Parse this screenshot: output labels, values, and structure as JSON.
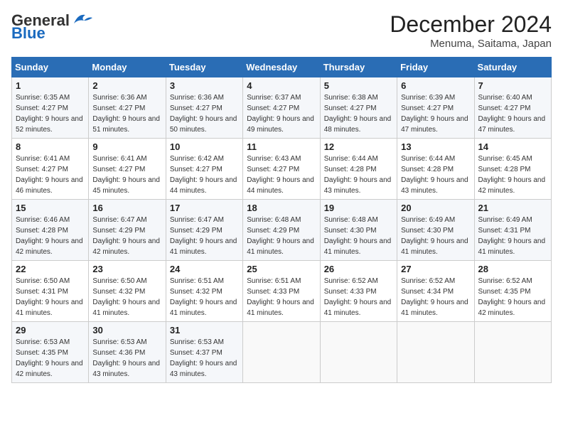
{
  "header": {
    "logo_general": "General",
    "logo_blue": "Blue",
    "title": "December 2024",
    "subtitle": "Menuma, Saitama, Japan"
  },
  "calendar": {
    "days_of_week": [
      "Sunday",
      "Monday",
      "Tuesday",
      "Wednesday",
      "Thursday",
      "Friday",
      "Saturday"
    ],
    "weeks": [
      [
        null,
        null,
        null,
        null,
        null,
        null,
        null
      ]
    ],
    "cells": [
      {
        "day": 1,
        "sunrise": "6:35 AM",
        "sunset": "4:27 PM",
        "daylight": "9 hours and 52 minutes."
      },
      {
        "day": 2,
        "sunrise": "6:36 AM",
        "sunset": "4:27 PM",
        "daylight": "9 hours and 51 minutes."
      },
      {
        "day": 3,
        "sunrise": "6:36 AM",
        "sunset": "4:27 PM",
        "daylight": "9 hours and 50 minutes."
      },
      {
        "day": 4,
        "sunrise": "6:37 AM",
        "sunset": "4:27 PM",
        "daylight": "9 hours and 49 minutes."
      },
      {
        "day": 5,
        "sunrise": "6:38 AM",
        "sunset": "4:27 PM",
        "daylight": "9 hours and 48 minutes."
      },
      {
        "day": 6,
        "sunrise": "6:39 AM",
        "sunset": "4:27 PM",
        "daylight": "9 hours and 47 minutes."
      },
      {
        "day": 7,
        "sunrise": "6:40 AM",
        "sunset": "4:27 PM",
        "daylight": "9 hours and 47 minutes."
      },
      {
        "day": 8,
        "sunrise": "6:41 AM",
        "sunset": "4:27 PM",
        "daylight": "9 hours and 46 minutes."
      },
      {
        "day": 9,
        "sunrise": "6:41 AM",
        "sunset": "4:27 PM",
        "daylight": "9 hours and 45 minutes."
      },
      {
        "day": 10,
        "sunrise": "6:42 AM",
        "sunset": "4:27 PM",
        "daylight": "9 hours and 44 minutes."
      },
      {
        "day": 11,
        "sunrise": "6:43 AM",
        "sunset": "4:27 PM",
        "daylight": "9 hours and 44 minutes."
      },
      {
        "day": 12,
        "sunrise": "6:44 AM",
        "sunset": "4:28 PM",
        "daylight": "9 hours and 43 minutes."
      },
      {
        "day": 13,
        "sunrise": "6:44 AM",
        "sunset": "4:28 PM",
        "daylight": "9 hours and 43 minutes."
      },
      {
        "day": 14,
        "sunrise": "6:45 AM",
        "sunset": "4:28 PM",
        "daylight": "9 hours and 42 minutes."
      },
      {
        "day": 15,
        "sunrise": "6:46 AM",
        "sunset": "4:28 PM",
        "daylight": "9 hours and 42 minutes."
      },
      {
        "day": 16,
        "sunrise": "6:47 AM",
        "sunset": "4:29 PM",
        "daylight": "9 hours and 42 minutes."
      },
      {
        "day": 17,
        "sunrise": "6:47 AM",
        "sunset": "4:29 PM",
        "daylight": "9 hours and 41 minutes."
      },
      {
        "day": 18,
        "sunrise": "6:48 AM",
        "sunset": "4:29 PM",
        "daylight": "9 hours and 41 minutes."
      },
      {
        "day": 19,
        "sunrise": "6:48 AM",
        "sunset": "4:30 PM",
        "daylight": "9 hours and 41 minutes."
      },
      {
        "day": 20,
        "sunrise": "6:49 AM",
        "sunset": "4:30 PM",
        "daylight": "9 hours and 41 minutes."
      },
      {
        "day": 21,
        "sunrise": "6:49 AM",
        "sunset": "4:31 PM",
        "daylight": "9 hours and 41 minutes."
      },
      {
        "day": 22,
        "sunrise": "6:50 AM",
        "sunset": "4:31 PM",
        "daylight": "9 hours and 41 minutes."
      },
      {
        "day": 23,
        "sunrise": "6:50 AM",
        "sunset": "4:32 PM",
        "daylight": "9 hours and 41 minutes."
      },
      {
        "day": 24,
        "sunrise": "6:51 AM",
        "sunset": "4:32 PM",
        "daylight": "9 hours and 41 minutes."
      },
      {
        "day": 25,
        "sunrise": "6:51 AM",
        "sunset": "4:33 PM",
        "daylight": "9 hours and 41 minutes."
      },
      {
        "day": 26,
        "sunrise": "6:52 AM",
        "sunset": "4:33 PM",
        "daylight": "9 hours and 41 minutes."
      },
      {
        "day": 27,
        "sunrise": "6:52 AM",
        "sunset": "4:34 PM",
        "daylight": "9 hours and 41 minutes."
      },
      {
        "day": 28,
        "sunrise": "6:52 AM",
        "sunset": "4:35 PM",
        "daylight": "9 hours and 42 minutes."
      },
      {
        "day": 29,
        "sunrise": "6:53 AM",
        "sunset": "4:35 PM",
        "daylight": "9 hours and 42 minutes."
      },
      {
        "day": 30,
        "sunrise": "6:53 AM",
        "sunset": "4:36 PM",
        "daylight": "9 hours and 43 minutes."
      },
      {
        "day": 31,
        "sunrise": "6:53 AM",
        "sunset": "4:37 PM",
        "daylight": "9 hours and 43 minutes."
      }
    ],
    "start_day_of_week": 0
  }
}
